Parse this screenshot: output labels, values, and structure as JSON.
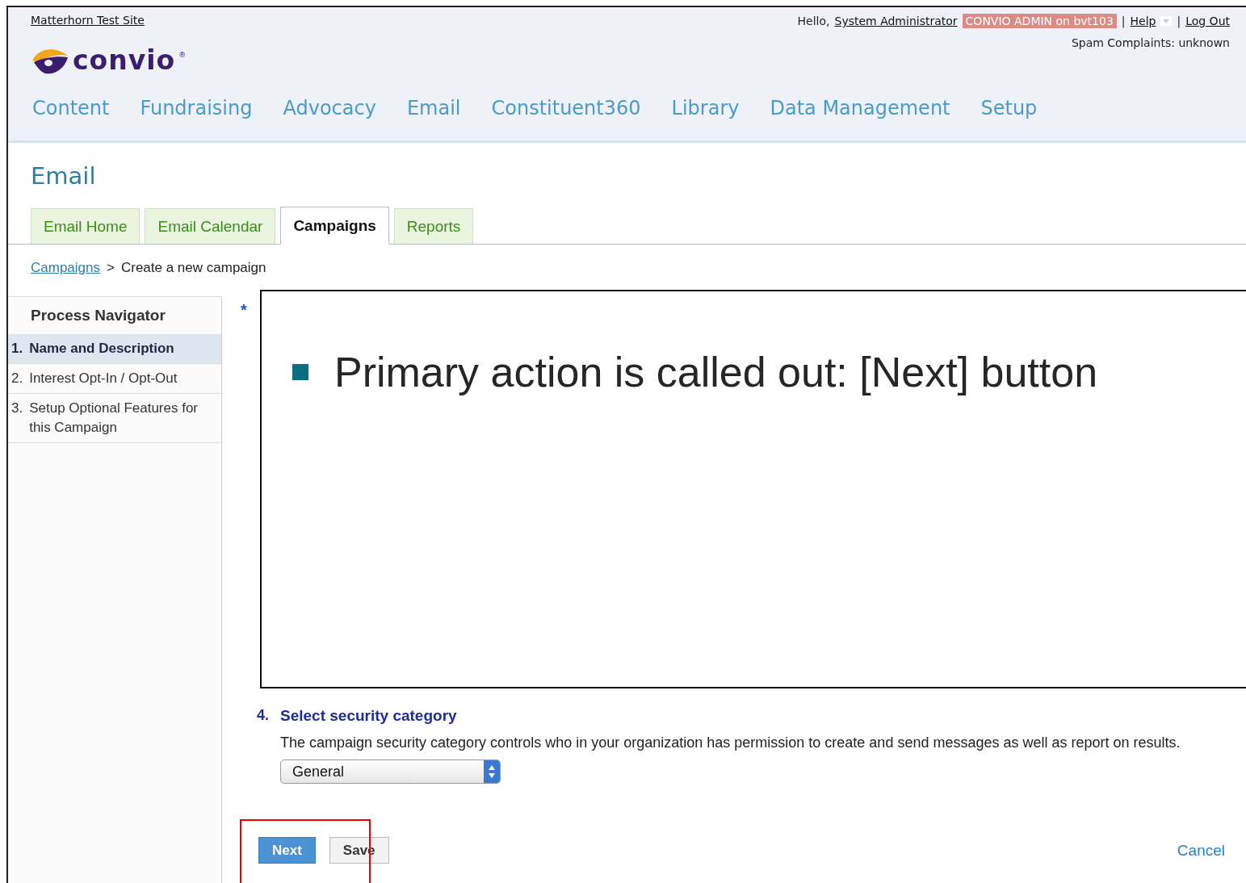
{
  "header": {
    "site_link": "Matterhorn Test Site",
    "greeting": "Hello,",
    "user_link": "System Administrator",
    "admin_badge": "CONVIO ADMIN on bvt103",
    "separator": "|",
    "help_link": "Help",
    "logout_link": "Log Out",
    "spam_status": "Spam Complaints: unknown",
    "logo": {
      "wordmark": "convio",
      "mark": "®"
    }
  },
  "nav": [
    "Content",
    "Fundraising",
    "Advocacy",
    "Email",
    "Constituent360",
    "Library",
    "Data Management",
    "Setup"
  ],
  "page_title": "Email",
  "tabs": [
    {
      "label": "Email Home",
      "selected": false
    },
    {
      "label": "Email Calendar",
      "selected": false
    },
    {
      "label": "Campaigns",
      "selected": true
    },
    {
      "label": "Reports",
      "selected": false
    }
  ],
  "breadcrumb": {
    "link": "Campaigns",
    "separator": ">",
    "current": "Create a new campaign"
  },
  "sidebar": {
    "title": "Process Navigator",
    "steps": [
      {
        "number": "1.",
        "label": "Name and Description",
        "selected": true
      },
      {
        "number": "2.",
        "label": "Interest Opt-In / Opt-Out",
        "selected": false
      },
      {
        "number": "3.",
        "label": "Setup Optional Features for this Campaign",
        "selected": false
      }
    ]
  },
  "form": {
    "required_mark": "*",
    "callout": "Primary action is called out: [Next] button",
    "steps": [
      {
        "number": "4.",
        "title": "Select security category",
        "help": "The campaign security category controls who in your organization has permission to create and send messages as well as report on results.",
        "kind": "select",
        "value": "General"
      }
    ],
    "buttons": [
      {
        "label": "Next",
        "kind": "primary"
      },
      {
        "label": "Save",
        "kind": "secondary"
      }
    ],
    "cancel_link": "Cancel"
  }
}
